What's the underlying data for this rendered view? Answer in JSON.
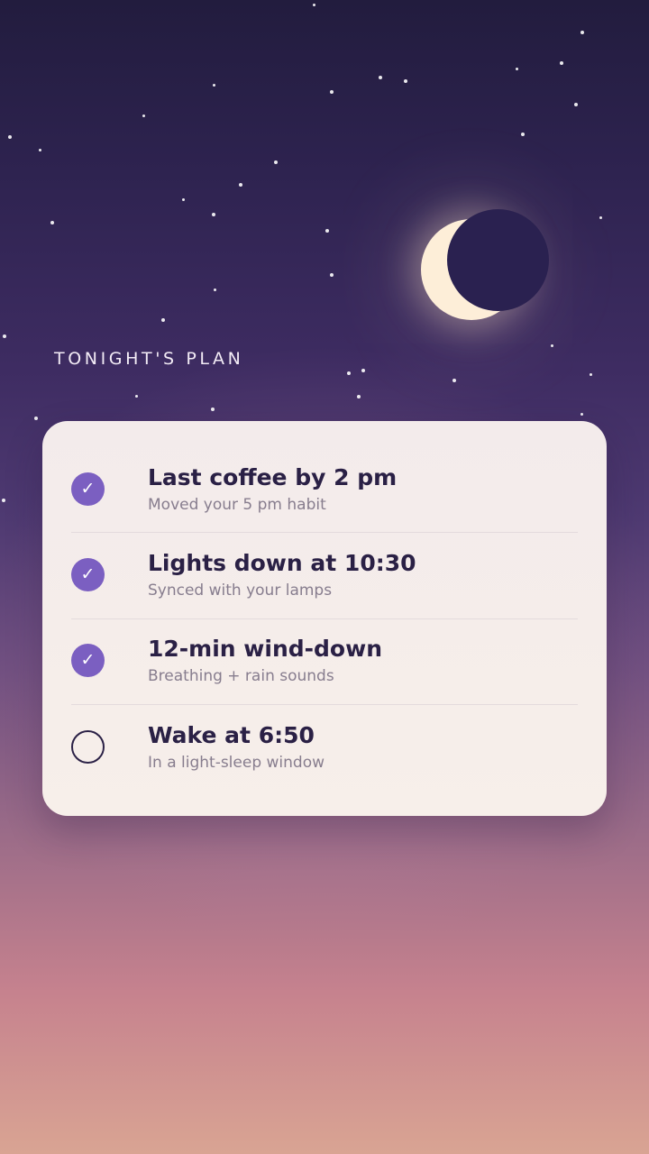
{
  "page": {
    "section_title": "TONIGHT'S PLAN"
  },
  "icons": {
    "moon": "crescent-moon-icon",
    "checked": "checkmark-icon",
    "unchecked": "empty-circle-icon"
  },
  "colors": {
    "accent": "#7b5fc1",
    "sky_top": "#221c3e",
    "sky_bottom": "#d9a493",
    "card_bg": "#f5eded",
    "title_text": "#2a2045",
    "subtitle_text": "#877d8e",
    "moon": "#fdeed8"
  },
  "plan": {
    "items": [
      {
        "title": "Last coffee by 2 pm",
        "subtitle": "Moved your 5 pm habit",
        "done": true
      },
      {
        "title": "Lights down at 10:30",
        "subtitle": "Synced with your lamps",
        "done": true
      },
      {
        "title": "12-min wind-down",
        "subtitle": "Breathing + rain sounds",
        "done": true
      },
      {
        "title": "Wake at 6:50",
        "subtitle": "In a light-sleep window",
        "done": false
      }
    ]
  }
}
